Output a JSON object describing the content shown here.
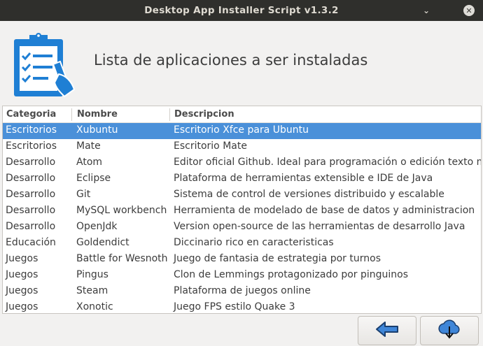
{
  "window": {
    "title": "Desktop App Installer Script v1.3.2",
    "minimize_glyph": "⌄",
    "close_glyph": "✕"
  },
  "header": {
    "title": "Lista de aplicaciones a ser instaladas",
    "icon": "clipboard-checklist-icon"
  },
  "table": {
    "columns": [
      "Categoria",
      "Nombre",
      "Descripcion"
    ],
    "selected_row": 0,
    "rows": [
      [
        "Escritorios",
        "Xubuntu",
        "Escritorio Xfce para Ubuntu"
      ],
      [
        "Escritorios",
        "Mate",
        "Escritorio Mate"
      ],
      [
        "Desarrollo",
        "Atom",
        "Editor oficial Github. Ideal para programación o edición texto ma"
      ],
      [
        "Desarrollo",
        "Eclipse",
        "Plataforma de herramientas extensible e IDE de Java"
      ],
      [
        "Desarrollo",
        "Git",
        "Sistema de control de versiones distribuido y escalable"
      ],
      [
        "Desarrollo",
        "MySQL workbench",
        "Herramienta de modelado de base de datos y administracion"
      ],
      [
        "Desarrollo",
        "OpenJdk",
        "Version open-source de las herramientas de desarrollo Java"
      ],
      [
        "Educación",
        "Goldendict",
        "Diccinario rico en caracteristicas"
      ],
      [
        "Juegos",
        "Battle for Wesnoth",
        "Juego de fantasia de estrategia por turnos"
      ],
      [
        "Juegos",
        "Pingus",
        "Clon de Lemmings protagonizado por pinguinos"
      ],
      [
        "Juegos",
        "Steam",
        "Plataforma de juegos online"
      ],
      [
        "Juegos",
        "Xonotic",
        "Juego FPS estilo Quake 3"
      ]
    ]
  },
  "buttons": {
    "back_icon": "arrow-left-icon",
    "install_icon": "cloud-download-icon"
  },
  "colors": {
    "selection": "#4a90d9",
    "logo_blue": "#1f7fd4",
    "titlebar": "#2f2f2c",
    "background": "#f2f1f0"
  }
}
